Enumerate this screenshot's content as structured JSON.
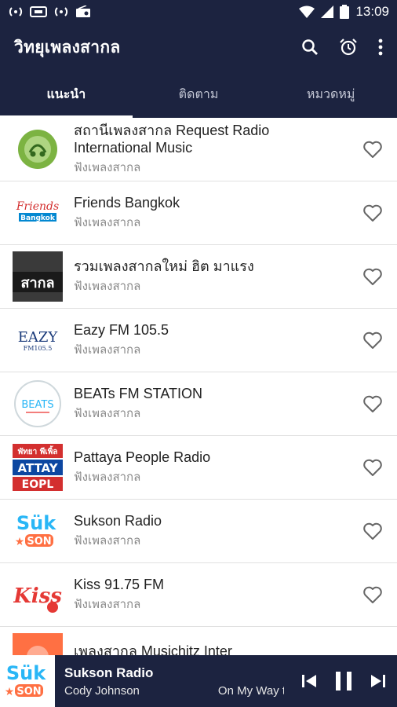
{
  "status_bar": {
    "time": "13:09"
  },
  "app_bar": {
    "title": "วิทยุเพลงสากล"
  },
  "tabs": [
    {
      "label": "แนะนำ",
      "active": true
    },
    {
      "label": "ติดตาม",
      "active": false
    },
    {
      "label": "หมวดหมู่",
      "active": false
    }
  ],
  "stations": [
    {
      "name": "สถานีเพลงสากล Request Radio International Music",
      "category": "ฟังเพลงสากล",
      "logo_icon": "request-radio-logo"
    },
    {
      "name": "Friends Bangkok",
      "category": "ฟังเพลงสากล",
      "logo_icon": "friends-bangkok-logo"
    },
    {
      "name": "รวมเพลงสากลใหม่ ฮิต มาแรง",
      "category": "ฟังเพลงสากล",
      "logo_icon": "sakol-logo"
    },
    {
      "name": "Eazy FM 105.5",
      "category": "ฟังเพลงสากล",
      "logo_icon": "eazy-fm-logo"
    },
    {
      "name": "BEATs FM STATION",
      "category": "ฟังเพลงสากล",
      "logo_icon": "beats-logo"
    },
    {
      "name": "Pattaya People Radio",
      "category": "ฟังเพลงสากล",
      "logo_icon": "pattaya-people-logo"
    },
    {
      "name": "Sukson Radio",
      "category": "ฟังเพลงสากล",
      "logo_icon": "sukson-logo"
    },
    {
      "name": "Kiss 91.75 FM",
      "category": "ฟังเพลงสากล",
      "logo_icon": "kiss-logo"
    },
    {
      "name": "เพลงสากล Musichitz Inter",
      "category": "",
      "logo_icon": "musichitz-logo"
    }
  ],
  "logo_text": {
    "eazy": "EAZY",
    "eazy_freq": "FM105.5",
    "beats": "BEATS",
    "pattaya_top": "พัทยา พีเพิ้ล",
    "pattaya_mid": "ATTAY",
    "pattaya_bot": "EOPL",
    "sukson": "Sük",
    "sukson_sub": "SON",
    "kiss": "Kiss",
    "sakol": "สากล",
    "friends": "Friends",
    "friends_sub": "Bangkok"
  },
  "player": {
    "station": "Sukson Radio",
    "artist": "Cody Johnson",
    "song": "On My Way to"
  },
  "colors": {
    "primary": "#1c2340",
    "divider": "#e0e0e0"
  }
}
